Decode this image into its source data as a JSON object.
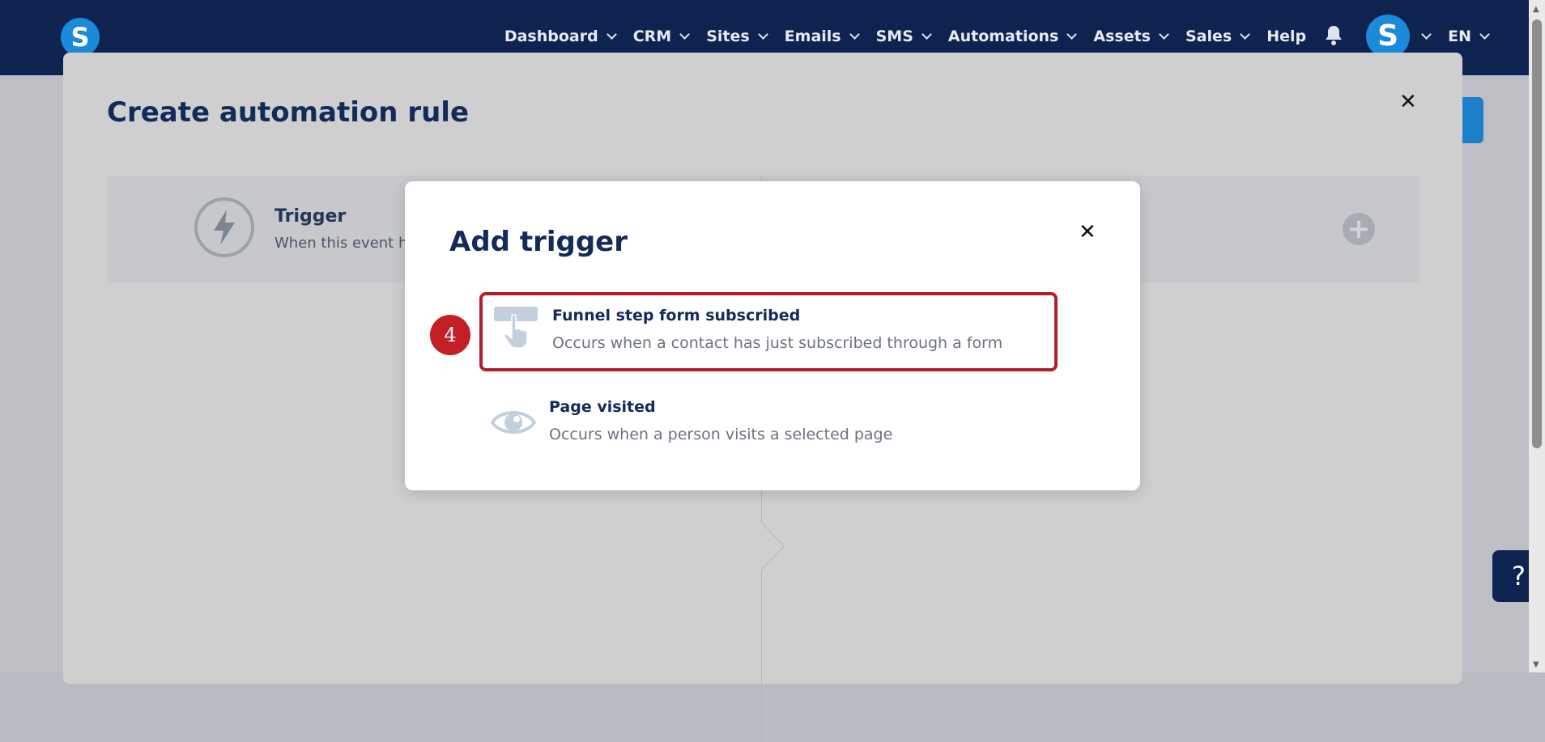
{
  "nav": {
    "logo_letter": "S",
    "items": [
      {
        "label": "Dashboard"
      },
      {
        "label": "CRM"
      },
      {
        "label": "Sites"
      },
      {
        "label": "Emails"
      },
      {
        "label": "SMS"
      },
      {
        "label": "Automations"
      },
      {
        "label": "Assets"
      },
      {
        "label": "Sales"
      }
    ],
    "help_label": "Help",
    "avatar_letter": "S",
    "language": "EN"
  },
  "outer_modal": {
    "title": "Create automation rule",
    "trigger_title": "Trigger",
    "trigger_subtitle": "When this event ha"
  },
  "inner_modal": {
    "title": "Add trigger",
    "options": [
      {
        "title": "Funnel step form subscribed",
        "description": "Occurs when a contact has just subscribed through a form",
        "icon": "hand-pointer-icon"
      },
      {
        "title": "Page visited",
        "description": "Occurs when a person visits a selected page",
        "icon": "eye-icon"
      }
    ]
  },
  "step_badge": "4",
  "help_fab": "?",
  "colors": {
    "navy": "#0f2350",
    "brand_blue": "#1a8ad9",
    "highlight_red": "#b0202a",
    "badge_red": "#c32026"
  }
}
